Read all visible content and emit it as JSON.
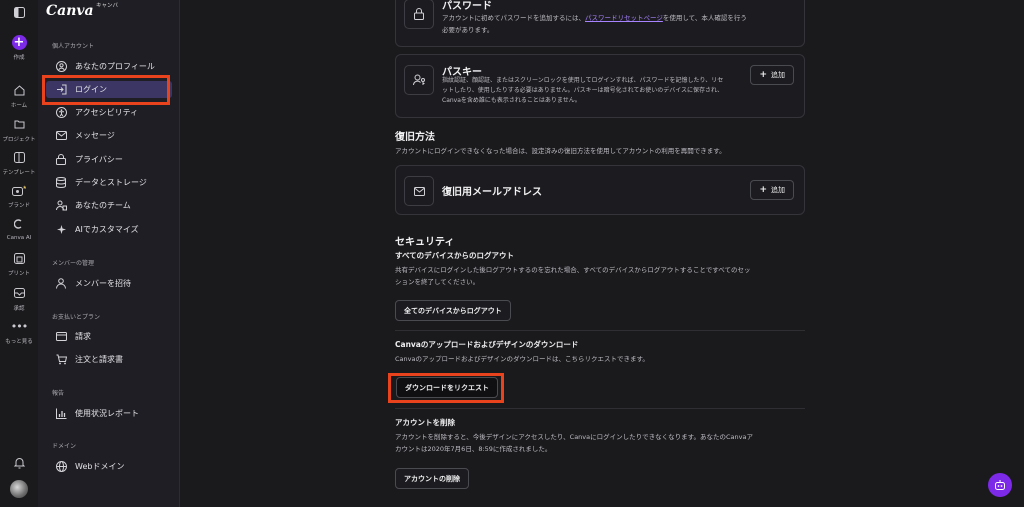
{
  "brand": {
    "logo": "Canva",
    "logo_sub": "キャンバ"
  },
  "rail": {
    "items": [
      {
        "label": "作成"
      },
      {
        "label": "ホーム"
      },
      {
        "label": "プロジェクト"
      },
      {
        "label": "テンプレート"
      },
      {
        "label": "ブランド"
      },
      {
        "label": "Canva AI"
      },
      {
        "label": "プリント"
      },
      {
        "label": "承認"
      },
      {
        "label": "もっと見る"
      }
    ]
  },
  "sidebar": {
    "sections": [
      {
        "title": "個人アカウント"
      },
      {
        "title": "メンバーの管理"
      },
      {
        "title": "お支払いとプラン"
      },
      {
        "title": "報告"
      },
      {
        "title": "ドメイン"
      }
    ],
    "items": [
      {
        "label": "あなたのプロフィール"
      },
      {
        "label": "ログイン"
      },
      {
        "label": "アクセシビリティ"
      },
      {
        "label": "メッセージ"
      },
      {
        "label": "プライバシー"
      },
      {
        "label": "データとストレージ"
      },
      {
        "label": "あなたのチーム"
      },
      {
        "label": "AIでカスタマイズ"
      },
      {
        "label": "メンバーを招待"
      },
      {
        "label": "請求"
      },
      {
        "label": "注文と請求書"
      },
      {
        "label": "使用状況レポート"
      },
      {
        "label": "Webドメイン"
      }
    ]
  },
  "password": {
    "title": "パスワード",
    "desc_before": "アカウントに初めてパスワードを追加するには、",
    "desc_link": "パスワードリセットページ",
    "desc_after": "を使用して、本人確認を行う",
    "desc_line2": "必要があります。"
  },
  "passkey": {
    "title": "パスキー",
    "desc_line1": "指紋認証、顔認証、またはスクリーンロックを使用してログインすれば、パスワードを記憶したり、リセ",
    "desc_line2": "ットしたり、使用したりする必要はありません。パスキーは暗号化されてお使いのデバイスに保存され、",
    "desc_line3": "Canvaを含め誰にも表示されることはありません。",
    "add_label": "追加"
  },
  "recovery": {
    "title": "復旧方法",
    "desc": "アカウントにログインできなくなった場合は、設定済みの復旧方法を使用してアカウントの利用を再開できます。",
    "email_title": "復旧用メールアドレス",
    "add_label": "追加"
  },
  "security": {
    "title": "セキュリティ",
    "logout_title": "すべてのデバイスからのログアウト",
    "logout_desc_line1": "共有デバイスにログインした後ログアウトするのを忘れた場合、すべてのデバイスからログアウトすることですべてのセッ",
    "logout_desc_line2": "ションを終了してください。",
    "logout_button": "全てのデバイスからログアウト",
    "download_title": "Canvaのアップロードおよびデザインのダウンロード",
    "download_desc": "Canvaのアップロードおよびデザインのダウンロードは、こちらリクエストできます。",
    "download_button": "ダウンロードをリクエスト",
    "delete_title": "アカウントを削除",
    "delete_desc_line1": "アカウントを削除すると、今後デザインにアクセスしたり、Canvaにログインしたりできなくなります。あなたのCanvaア",
    "delete_desc_line2": "カウントは2020年7月6日、8:59に作成されました。",
    "delete_button": "アカウントの削除"
  },
  "colors": {
    "accent": "#7d2ae8",
    "highlight": "#e8431c",
    "active_bg": "#3b3664",
    "link": "#a783ff"
  },
  "icons": [
    "panel-toggle-icon",
    "plus-icon",
    "home-icon",
    "folder-icon",
    "template-icon",
    "brand-icon",
    "canva-ai-icon",
    "print-icon",
    "approval-icon",
    "more-icon",
    "bell-icon",
    "lock-icon",
    "passkey-icon",
    "mail-icon",
    "assistant-icon"
  ]
}
